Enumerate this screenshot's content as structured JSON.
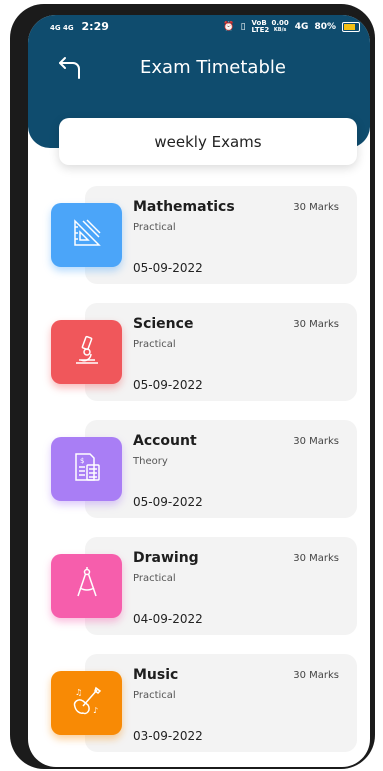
{
  "status_bar": {
    "signal_left": "4G 4G",
    "time": "2:29",
    "net_speed": "0.00",
    "net_speed_unit": "KB/s",
    "net_label": "4G",
    "lte": "VoB LTE2",
    "battery": "80%"
  },
  "header": {
    "title": "Exam Timetable"
  },
  "tab": {
    "label": "weekly Exams"
  },
  "exams": [
    {
      "subject": "Mathematics",
      "type": "Practical",
      "marks": "30 Marks",
      "date": "05-09-2022",
      "icon": "geometry-tools-icon",
      "color": "#4ba5f9"
    },
    {
      "subject": "Science",
      "type": "Practical",
      "marks": "30 Marks",
      "date": "05-09-2022",
      "icon": "microscope-icon",
      "color": "#f0575b"
    },
    {
      "subject": "Account",
      "type": "Theory",
      "marks": "30 Marks",
      "date": "05-09-2022",
      "icon": "calculator-document-icon",
      "color": "#a97ef5"
    },
    {
      "subject": "Drawing",
      "type": "Practical",
      "marks": "30 Marks",
      "date": "04-09-2022",
      "icon": "compass-icon",
      "color": "#f65eac"
    },
    {
      "subject": "Music",
      "type": "Practical",
      "marks": "30 Marks",
      "date": "03-09-2022",
      "icon": "guitar-icon",
      "color": "#f88a05"
    }
  ]
}
